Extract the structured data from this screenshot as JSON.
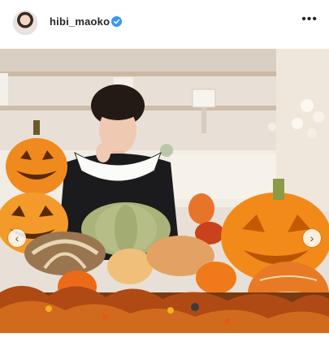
{
  "post": {
    "username": "hibi_maoko",
    "more_label": "•••"
  },
  "nav": {
    "prev_glyph": "‹",
    "next_glyph": "›"
  },
  "icons": {
    "verified": "verified-badge-icon",
    "more": "more-options-icon"
  },
  "colors": {
    "verified_blue": "#3897f0",
    "pumpkin_orange": "#f08a1e"
  }
}
